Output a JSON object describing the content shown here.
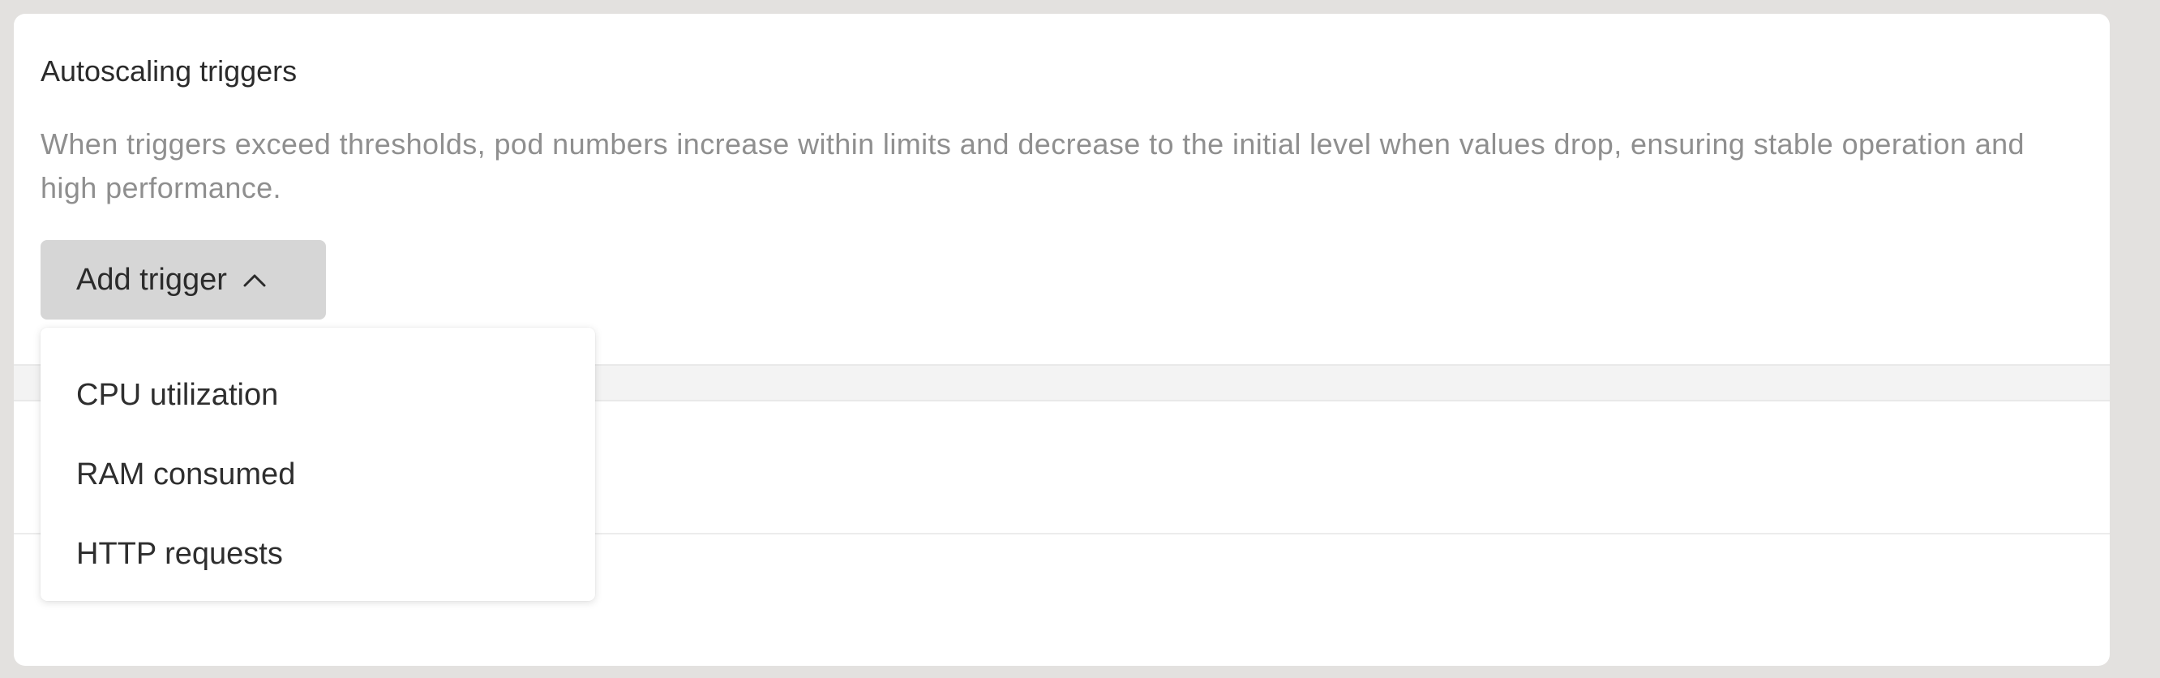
{
  "section": {
    "title": "Autoscaling triggers",
    "description": "When triggers exceed thresholds, pod numbers increase within limits and decrease to the initial level when values drop, ensuring stable operation and high performance."
  },
  "add_trigger": {
    "label": "Add trigger",
    "icon": "chevron-up-icon",
    "expanded": true
  },
  "dropdown": {
    "items": [
      {
        "label": "CPU utilization"
      },
      {
        "label": "RAM consumed"
      },
      {
        "label": "HTTP requests"
      }
    ]
  },
  "colors": {
    "button_bg": "#d6d6d6",
    "description_text": "#8f8f8f",
    "title_text": "#2b2b2b",
    "outer_frame": "#e3e1df"
  }
}
